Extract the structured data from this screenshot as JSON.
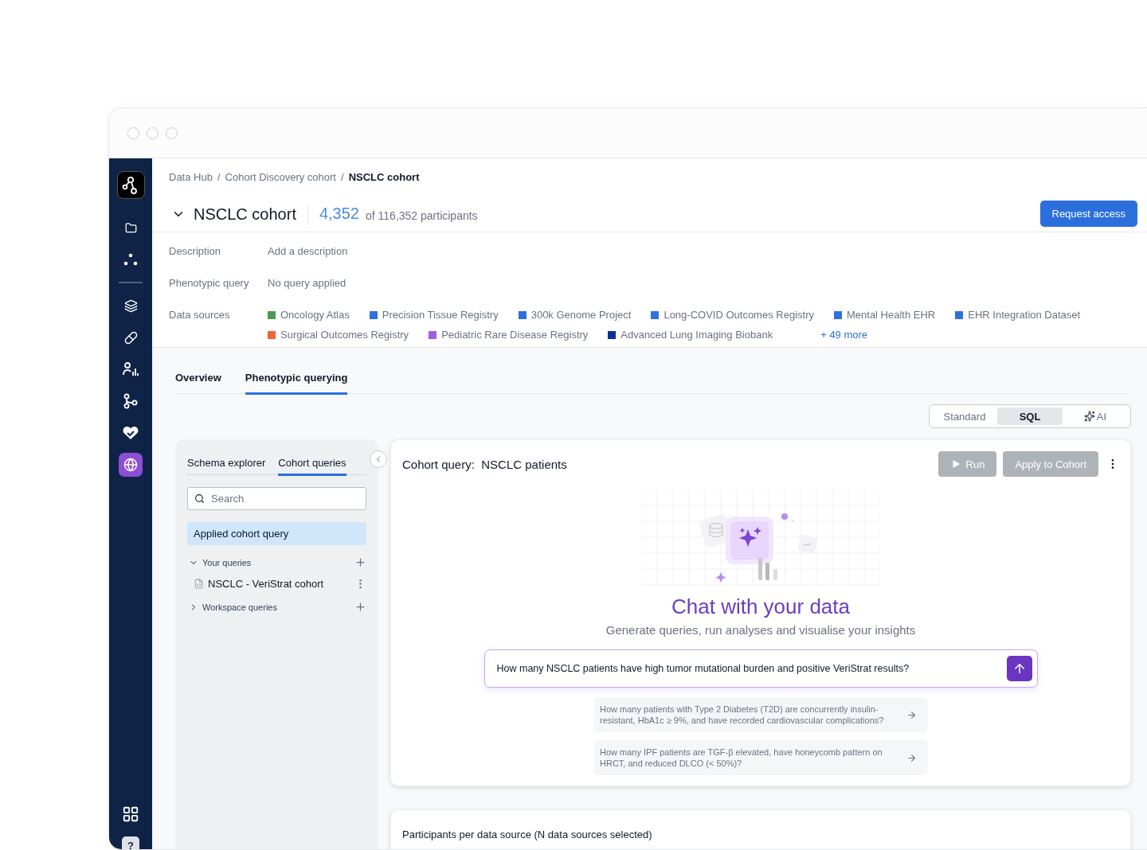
{
  "sidebar": {
    "top": [
      {
        "kind": "folder",
        "selected": false
      },
      {
        "kind": "nodes",
        "selected": false
      }
    ],
    "main": [
      {
        "kind": "layers",
        "selected": false
      },
      {
        "kind": "pill",
        "selected": false
      },
      {
        "kind": "analytics",
        "selected": false
      },
      {
        "kind": "branch",
        "selected": false
      },
      {
        "kind": "health",
        "selected": false
      },
      {
        "kind": "globe",
        "selected": true
      }
    ],
    "bottom": [
      {
        "kind": "apps"
      },
      {
        "kind": "help",
        "label": "?"
      }
    ]
  },
  "breadcrumbs": {
    "separator": "/",
    "items": [
      "Data Hub",
      "Cohort Discovery cohort",
      "NSCLC cohort"
    ]
  },
  "header": {
    "title": "NSCLC cohort",
    "expanded": true,
    "count": "4,352",
    "total": "of 116,352 participants",
    "button": "Request access"
  },
  "details": [
    {
      "label": "Description",
      "value": "Add a description"
    },
    {
      "label": "Phenotypic query",
      "value": "No query applied"
    }
  ],
  "data_sources": {
    "label": "Data sources",
    "rows": [
      [
        {
          "name": "Oncology Atlas",
          "color": "#4c9a52"
        },
        {
          "name": "Precision Tissue Registry",
          "color": "#2f6fdf"
        },
        {
          "name": "300k Genome Project",
          "color": "#2f6fdf"
        },
        {
          "name": "Long-COVID Outcomes Registry",
          "color": "#2f6fdf"
        },
        {
          "name": "Mental Health EHR",
          "color": "#2f6fdf"
        },
        {
          "name": "EHR Integration Dataset",
          "color": "#2f6fdf"
        }
      ],
      [
        {
          "name": "Surgical Outcomes Registry",
          "color": "#f4623a"
        },
        {
          "name": "Pediatric Rare Disease Registry",
          "color": "#9b5fe0"
        },
        {
          "name": "Advanced Lung Imaging Biobank",
          "color": "#0a2f9e"
        }
      ]
    ],
    "more": "+ 49 more"
  },
  "tabs": [
    {
      "label": "Overview",
      "selected": false
    },
    {
      "label": "Phenotypic querying",
      "selected": true
    }
  ],
  "modes": [
    {
      "label": "Standard",
      "kind": "plain",
      "selected": false
    },
    {
      "label": "SQL",
      "kind": "plain",
      "selected": true
    },
    {
      "label": "AI",
      "kind": "ai",
      "selected": false
    }
  ],
  "left_panel": {
    "tabs": [
      {
        "label": "Schema explorer",
        "selected": false
      },
      {
        "label": "Cohort queries",
        "selected": true
      }
    ],
    "search": {
      "placeholder": "Search"
    },
    "applied": {
      "label": "Applied cohort query",
      "selected": true
    },
    "groups": [
      {
        "label": "Your queries",
        "expanded": true,
        "children": [
          {
            "label": "NSCLC - VeriStrat cohort"
          }
        ]
      },
      {
        "label": "Workspace queries",
        "expanded": false
      }
    ]
  },
  "query_card": {
    "title_label": "Cohort query:",
    "title": "NSCLC patients",
    "run": "Run",
    "apply": "Apply to Cohort",
    "disabled": true,
    "heading": "Chat with your data",
    "subheading": "Generate queries, run analyses and visualise your insights",
    "prompt": {
      "value": "How many NSCLC patients have high tumor mutational burden and positive VeriStrat results?"
    },
    "suggestions": [
      "How many patients with Type 2 Diabetes (T2D) are concurrently insulin-resistant, HbA1c ≥ 9%, and have recorded cardiovascular complications?",
      "How many IPF patients are TGF-β elevated, have honeycomb pattern on HRCT, and reduced DLCO (< 50%)?"
    ]
  },
  "participants_card": {
    "title": "Participants per data source (N data sources selected)"
  }
}
